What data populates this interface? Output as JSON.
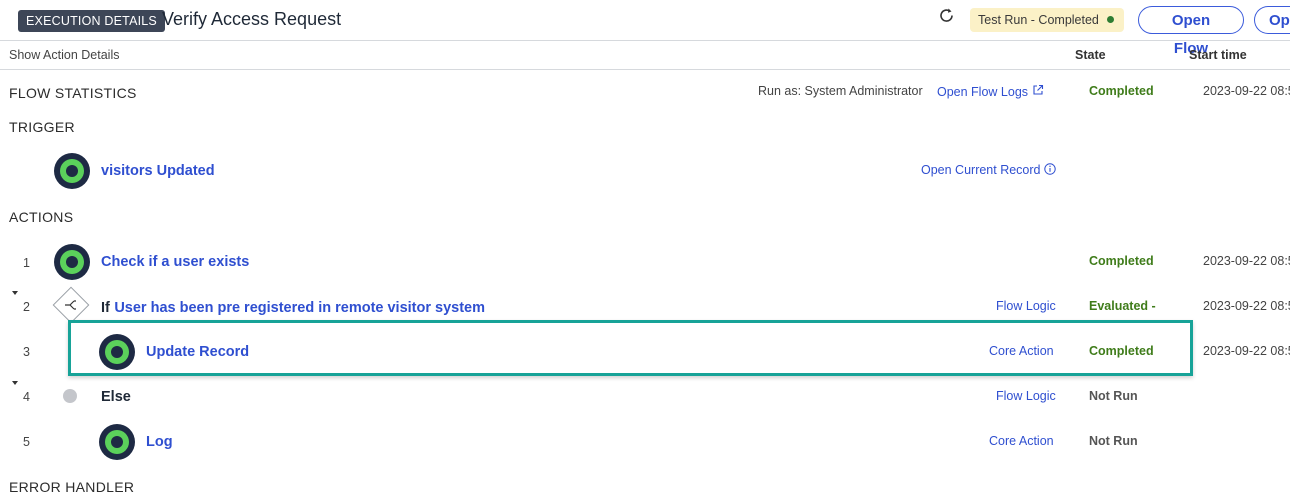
{
  "header": {
    "badge": "EXECUTION DETAILS",
    "title": "Verify Access Request",
    "status": "Test Run - Completed",
    "open_flow": "Open Flow",
    "open_truncated": "Ope"
  },
  "columns": {
    "show_action_details": "Show Action Details",
    "state": "State",
    "start_time": "Start time"
  },
  "flow_statistics": {
    "label": "FLOW STATISTICS",
    "run_as": "Run as: System Administrator",
    "open_logs": "Open Flow Logs",
    "state": "Completed",
    "start": "2023-09-22 08:5"
  },
  "trigger": {
    "label": "TRIGGER",
    "name": "visitors Updated",
    "link": "Open Current Record"
  },
  "actions_label": "ACTIONS",
  "rows": [
    {
      "num": "1",
      "prefix": "",
      "name": "Check if a user exists",
      "type": "",
      "state": "Completed",
      "start": "2023-09-22 08:5"
    },
    {
      "num": "2",
      "prefix": "If",
      "name": "User has been pre registered in remote visitor system",
      "type": "Flow Logic",
      "state": "Evaluated - True",
      "start": "2023-09-22 08:5"
    },
    {
      "num": "3",
      "prefix": "",
      "name": "Update Record",
      "type": "Core Action",
      "state": "Completed",
      "start": "2023-09-22 08:5"
    },
    {
      "num": "4",
      "prefix": "",
      "name": "Else",
      "type": "Flow Logic",
      "state": "Not Run",
      "start": ""
    },
    {
      "num": "5",
      "prefix": "",
      "name": "Log",
      "type": "Core Action",
      "state": "Not Run",
      "start": ""
    }
  ],
  "error_handler_label": "ERROR HANDLER",
  "colors": {
    "accent": "#2f4fd0",
    "completed": "#3f7c1a",
    "highlight": "#17a398",
    "status_bg": "#fbf1c7"
  }
}
